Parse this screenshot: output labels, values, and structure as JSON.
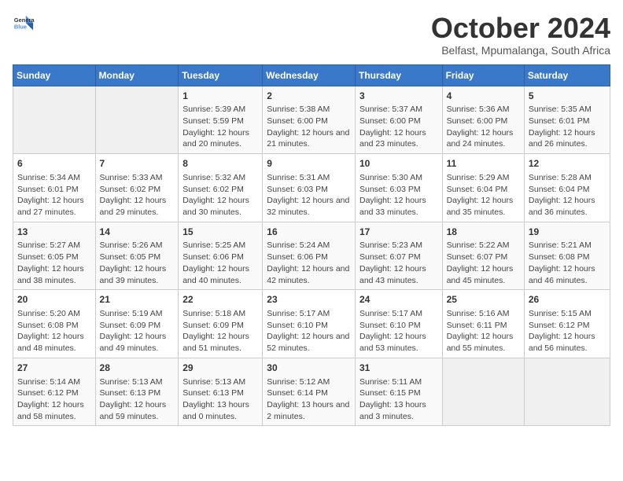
{
  "header": {
    "logo_line1": "General",
    "logo_line2": "Blue",
    "month": "October 2024",
    "location": "Belfast, Mpumalanga, South Africa"
  },
  "weekdays": [
    "Sunday",
    "Monday",
    "Tuesday",
    "Wednesday",
    "Thursday",
    "Friday",
    "Saturday"
  ],
  "weeks": [
    [
      {
        "day": "",
        "empty": true
      },
      {
        "day": "",
        "empty": true
      },
      {
        "day": "1",
        "sunrise": "5:39 AM",
        "sunset": "5:59 PM",
        "daylight": "12 hours and 20 minutes."
      },
      {
        "day": "2",
        "sunrise": "5:38 AM",
        "sunset": "6:00 PM",
        "daylight": "12 hours and 21 minutes."
      },
      {
        "day": "3",
        "sunrise": "5:37 AM",
        "sunset": "6:00 PM",
        "daylight": "12 hours and 23 minutes."
      },
      {
        "day": "4",
        "sunrise": "5:36 AM",
        "sunset": "6:00 PM",
        "daylight": "12 hours and 24 minutes."
      },
      {
        "day": "5",
        "sunrise": "5:35 AM",
        "sunset": "6:01 PM",
        "daylight": "12 hours and 26 minutes."
      }
    ],
    [
      {
        "day": "6",
        "sunrise": "5:34 AM",
        "sunset": "6:01 PM",
        "daylight": "12 hours and 27 minutes."
      },
      {
        "day": "7",
        "sunrise": "5:33 AM",
        "sunset": "6:02 PM",
        "daylight": "12 hours and 29 minutes."
      },
      {
        "day": "8",
        "sunrise": "5:32 AM",
        "sunset": "6:02 PM",
        "daylight": "12 hours and 30 minutes."
      },
      {
        "day": "9",
        "sunrise": "5:31 AM",
        "sunset": "6:03 PM",
        "daylight": "12 hours and 32 minutes."
      },
      {
        "day": "10",
        "sunrise": "5:30 AM",
        "sunset": "6:03 PM",
        "daylight": "12 hours and 33 minutes."
      },
      {
        "day": "11",
        "sunrise": "5:29 AM",
        "sunset": "6:04 PM",
        "daylight": "12 hours and 35 minutes."
      },
      {
        "day": "12",
        "sunrise": "5:28 AM",
        "sunset": "6:04 PM",
        "daylight": "12 hours and 36 minutes."
      }
    ],
    [
      {
        "day": "13",
        "sunrise": "5:27 AM",
        "sunset": "6:05 PM",
        "daylight": "12 hours and 38 minutes."
      },
      {
        "day": "14",
        "sunrise": "5:26 AM",
        "sunset": "6:05 PM",
        "daylight": "12 hours and 39 minutes."
      },
      {
        "day": "15",
        "sunrise": "5:25 AM",
        "sunset": "6:06 PM",
        "daylight": "12 hours and 40 minutes."
      },
      {
        "day": "16",
        "sunrise": "5:24 AM",
        "sunset": "6:06 PM",
        "daylight": "12 hours and 42 minutes."
      },
      {
        "day": "17",
        "sunrise": "5:23 AM",
        "sunset": "6:07 PM",
        "daylight": "12 hours and 43 minutes."
      },
      {
        "day": "18",
        "sunrise": "5:22 AM",
        "sunset": "6:07 PM",
        "daylight": "12 hours and 45 minutes."
      },
      {
        "day": "19",
        "sunrise": "5:21 AM",
        "sunset": "6:08 PM",
        "daylight": "12 hours and 46 minutes."
      }
    ],
    [
      {
        "day": "20",
        "sunrise": "5:20 AM",
        "sunset": "6:08 PM",
        "daylight": "12 hours and 48 minutes."
      },
      {
        "day": "21",
        "sunrise": "5:19 AM",
        "sunset": "6:09 PM",
        "daylight": "12 hours and 49 minutes."
      },
      {
        "day": "22",
        "sunrise": "5:18 AM",
        "sunset": "6:09 PM",
        "daylight": "12 hours and 51 minutes."
      },
      {
        "day": "23",
        "sunrise": "5:17 AM",
        "sunset": "6:10 PM",
        "daylight": "12 hours and 52 minutes."
      },
      {
        "day": "24",
        "sunrise": "5:17 AM",
        "sunset": "6:10 PM",
        "daylight": "12 hours and 53 minutes."
      },
      {
        "day": "25",
        "sunrise": "5:16 AM",
        "sunset": "6:11 PM",
        "daylight": "12 hours and 55 minutes."
      },
      {
        "day": "26",
        "sunrise": "5:15 AM",
        "sunset": "6:12 PM",
        "daylight": "12 hours and 56 minutes."
      }
    ],
    [
      {
        "day": "27",
        "sunrise": "5:14 AM",
        "sunset": "6:12 PM",
        "daylight": "12 hours and 58 minutes."
      },
      {
        "day": "28",
        "sunrise": "5:13 AM",
        "sunset": "6:13 PM",
        "daylight": "12 hours and 59 minutes."
      },
      {
        "day": "29",
        "sunrise": "5:13 AM",
        "sunset": "6:13 PM",
        "daylight": "13 hours and 0 minutes."
      },
      {
        "day": "30",
        "sunrise": "5:12 AM",
        "sunset": "6:14 PM",
        "daylight": "13 hours and 2 minutes."
      },
      {
        "day": "31",
        "sunrise": "5:11 AM",
        "sunset": "6:15 PM",
        "daylight": "13 hours and 3 minutes."
      },
      {
        "day": "",
        "empty": true
      },
      {
        "day": "",
        "empty": true
      }
    ]
  ],
  "labels": {
    "sunrise": "Sunrise:",
    "sunset": "Sunset:",
    "daylight": "Daylight:"
  }
}
